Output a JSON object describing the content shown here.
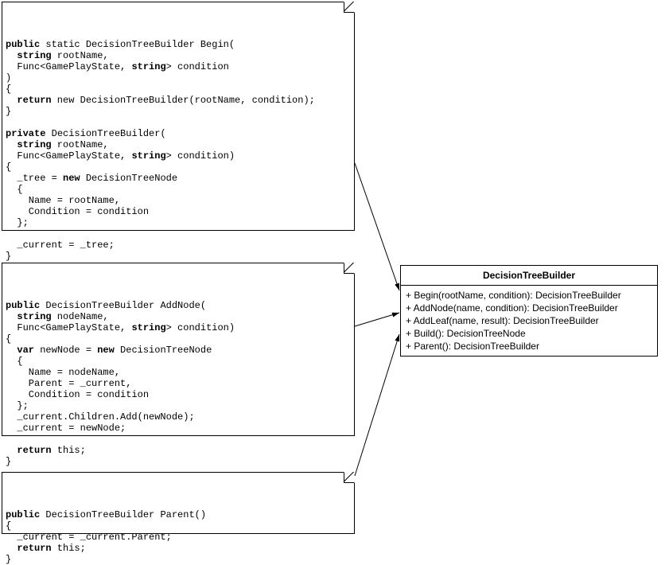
{
  "uml": {
    "className": "DecisionTreeBuilder",
    "methods": [
      "+ Begin(rootName, condition): DecisionTreeBuilder",
      "+ AddNode(name, condition): DecisionTreeBuilder",
      "+ AddLeaf(name, result): DecisionTreeBuilder",
      "+ Build(): DecisionTreeNode",
      "+ Parent(): DecisionTreeBuilder"
    ]
  },
  "code": {
    "begin": {
      "l1a": "public",
      "l1b": " static DecisionTreeBuilder Begin(",
      "l2a": "  string",
      "l2b": " rootName,",
      "l3a": "  Func<GamePlayState, ",
      "l3b": "string",
      "l3c": "> condition",
      "l4": ")",
      "l5": "{",
      "l6a": "  return",
      "l6b": " new DecisionTreeBuilder(rootName, condition);",
      "l7": "}",
      "l8": "",
      "l9a": "private",
      "l9b": " DecisionTreeBuilder(",
      "l10a": "  string",
      "l10b": " rootName,",
      "l11a": "  Func<GamePlayState, ",
      "l11b": "string",
      "l11c": "> condition)",
      "l12": "{",
      "l13a": "  _tree = ",
      "l13b": "new",
      "l13c": " DecisionTreeNode",
      "l14": "  {",
      "l15": "    Name = rootName,",
      "l16": "    Condition = condition",
      "l17": "  };",
      "l18": "",
      "l19": "  _current = _tree;",
      "l20": "}"
    },
    "addnode": {
      "l1a": "public",
      "l1b": " DecisionTreeBuilder AddNode(",
      "l2a": "  string",
      "l2b": " nodeName,",
      "l3a": "  Func<GamePlayState, ",
      "l3b": "string",
      "l3c": "> condition)",
      "l4": "{",
      "l5a": "  var",
      "l5b": " newNode = ",
      "l5c": "new",
      "l5d": " DecisionTreeNode",
      "l6": "  {",
      "l7": "    Name = nodeName,",
      "l8": "    Parent = _current,",
      "l9": "    Condition = condition",
      "l10": "  };",
      "l11": "  _current.Children.Add(newNode);",
      "l12": "  _current = newNode;",
      "l13": "",
      "l14a": "  return",
      "l14b": " this;",
      "l15": "}"
    },
    "parent": {
      "l1a": "public",
      "l1b": " DecisionTreeBuilder Parent()",
      "l2": "{",
      "l3": "  _current = _current.Parent;",
      "l4a": "  return",
      "l4b": " this;",
      "l5": "}"
    }
  }
}
